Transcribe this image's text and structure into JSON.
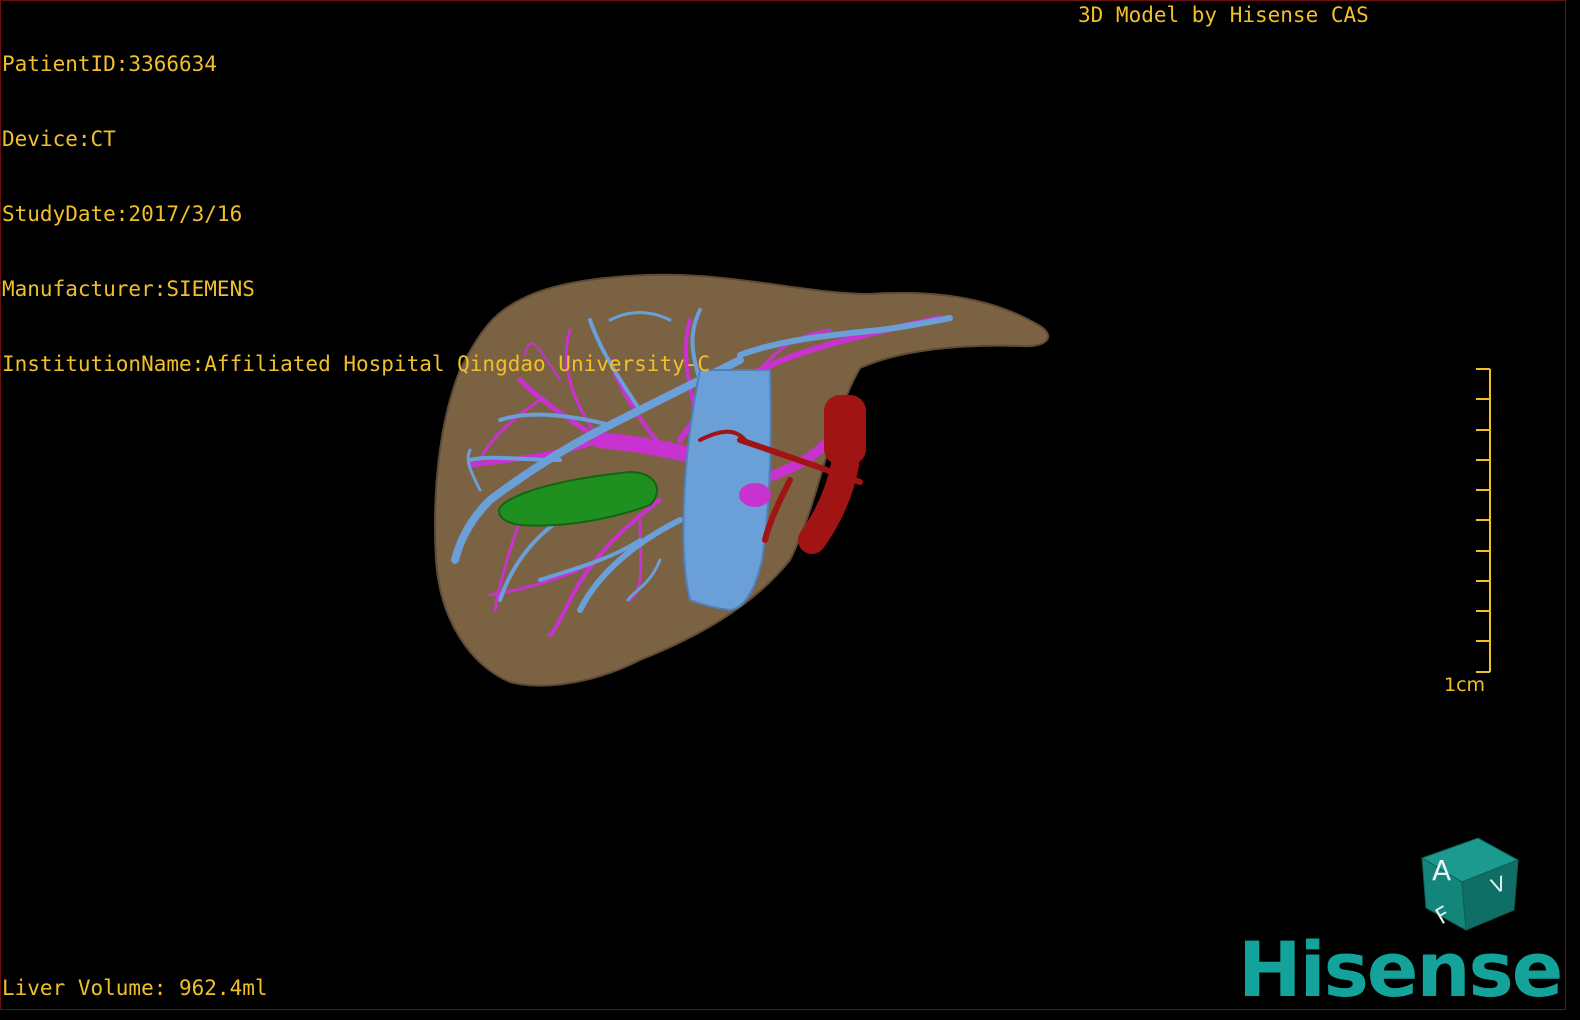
{
  "patient": {
    "id_line": "PatientID:3366634",
    "device_line": "Device:CT",
    "study_date_line": "StudyDate:2017/3/16",
    "manufacturer_line": "Manufacturer:SIEMENS",
    "institution_line": "InstitutionName:Affiliated Hospital Qingdao University-C"
  },
  "watermark": "3D Model by Hisense CAS",
  "footer": {
    "liver_volume": "Liver Volume: 962.4ml"
  },
  "scale": {
    "label": "1cm",
    "ticks": 11
  },
  "orientation_cube": {
    "face_front": "A",
    "face_bottom": "F",
    "face_right": "V",
    "icon": "orientation-cube-icon"
  },
  "brand": {
    "logo_text": "Hisense",
    "color": "#13a39b"
  },
  "colors": {
    "text": "#f0c02a",
    "liver": "#7b6243",
    "portal_vein": "#6a9fd8",
    "hepatic_vein": "#c832d0",
    "artery": "#a01414",
    "gallbladder": "#1f8f1f"
  }
}
